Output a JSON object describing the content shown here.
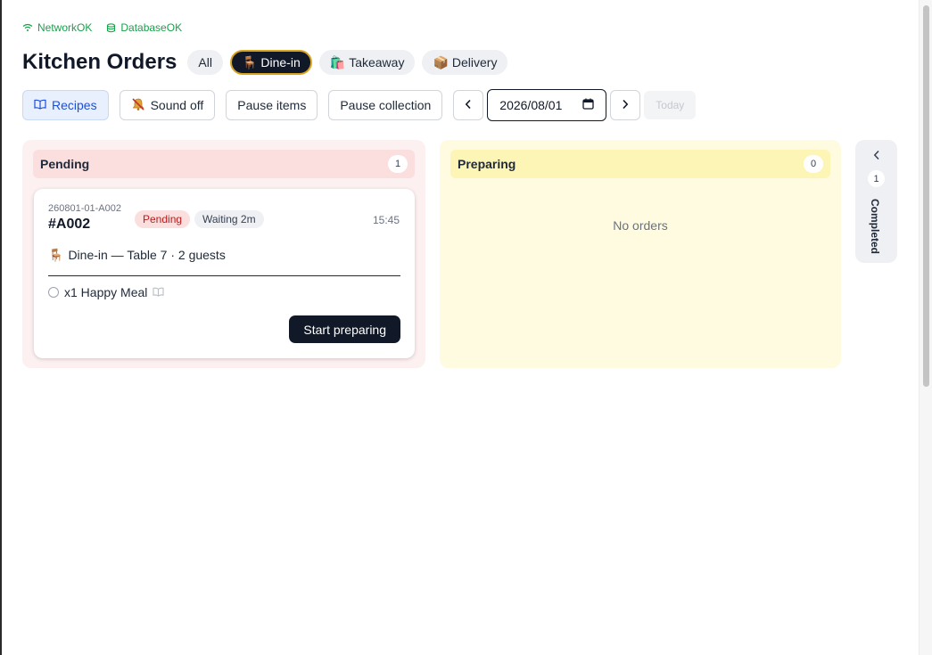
{
  "status": {
    "network": "NetworkOK",
    "database": "DatabaseOK",
    "ok_color": "#16a34a"
  },
  "header": {
    "title": "Kitchen Orders",
    "filters": [
      {
        "label": "All",
        "icon": ""
      },
      {
        "label": "Dine-in",
        "icon": "🪑",
        "active": true
      },
      {
        "label": "Takeaway",
        "icon": "🛍️"
      },
      {
        "label": "Delivery",
        "icon": "📦"
      }
    ]
  },
  "toolbar": {
    "recipes": "Recipes",
    "sound_off": "Sound off",
    "pause_items": "Pause items",
    "pause_collection": "Pause collection",
    "date": "2026/08/01",
    "today": "Today"
  },
  "columns": {
    "pending": {
      "title": "Pending",
      "count": "1",
      "color": "#fdf0f0"
    },
    "preparing": {
      "title": "Preparing",
      "count": "0",
      "empty": "No orders",
      "color": "#fefbe1"
    },
    "completed": {
      "title": "Completed",
      "count": "1"
    }
  },
  "order": {
    "code": "260801-01-A002",
    "number": "#A002",
    "status": "Pending",
    "waiting": "Waiting 2m",
    "time": "15:45",
    "meta": "Dine-in — Table 7 · 2 guests",
    "item": "x1 Happy Meal",
    "action": "Start preparing"
  }
}
